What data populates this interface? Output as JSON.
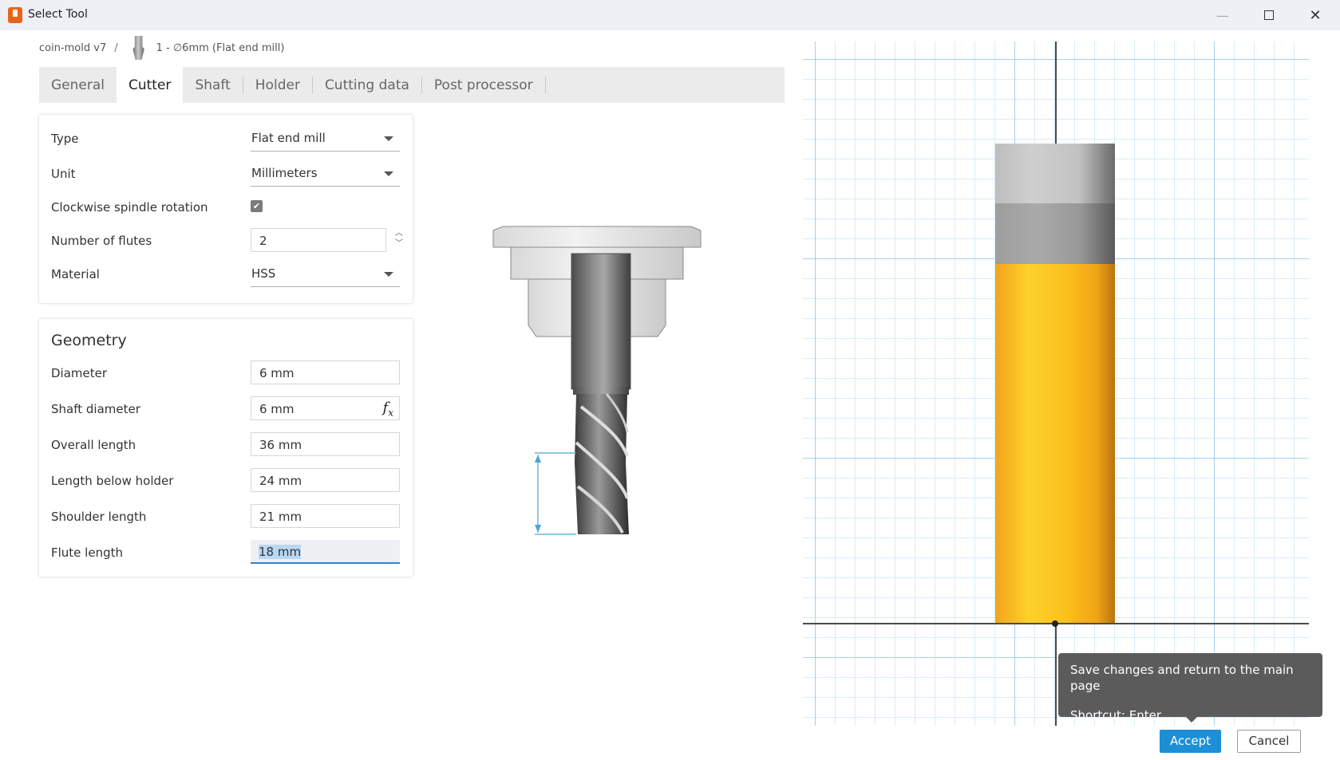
{
  "window": {
    "title": "Select Tool"
  },
  "breadcrumb": {
    "document": "coin-mold v7",
    "separator": "/",
    "tool": "1 - ∅6mm (Flat end mill)"
  },
  "tabs": [
    {
      "label": "General",
      "active": false
    },
    {
      "label": "Cutter",
      "active": true
    },
    {
      "label": "Shaft",
      "active": false
    },
    {
      "label": "Holder",
      "active": false
    },
    {
      "label": "Cutting data",
      "active": false
    },
    {
      "label": "Post processor",
      "active": false
    }
  ],
  "cutter": {
    "type": {
      "label": "Type",
      "value": "Flat end mill"
    },
    "unit": {
      "label": "Unit",
      "value": "Millimeters"
    },
    "clockwise": {
      "label": "Clockwise spindle rotation",
      "checked": true
    },
    "flutes": {
      "label": "Number of flutes",
      "value": "2"
    },
    "material": {
      "label": "Material",
      "value": "HSS"
    }
  },
  "geometry": {
    "title": "Geometry",
    "diameter": {
      "label": "Diameter",
      "value": "6 mm"
    },
    "shaft_diameter": {
      "label": "Shaft diameter",
      "value": "6 mm"
    },
    "overall_length": {
      "label": "Overall length",
      "value": "36 mm"
    },
    "length_below_holder": {
      "label": "Length below holder",
      "value": "24 mm"
    },
    "shoulder_length": {
      "label": "Shoulder length",
      "value": "21 mm"
    },
    "flute_length": {
      "label": "Flute length",
      "value": "18 mm"
    }
  },
  "tooltip": {
    "line1": "Save changes and return to the main page",
    "line2": "Shortcut: Enter"
  },
  "buttons": {
    "accept": "Accept",
    "cancel": "Cancel"
  },
  "colors": {
    "accent": "#1d8fd6",
    "flute_yellow": "#fbbf1d",
    "grid_blue": "#78bee1"
  },
  "icons": {
    "app": "fusion-app-icon",
    "tool_thumbnail": "end-mill-thumbnail-icon",
    "dropdown": "chevron-down-icon",
    "fx": "formula-icon"
  }
}
